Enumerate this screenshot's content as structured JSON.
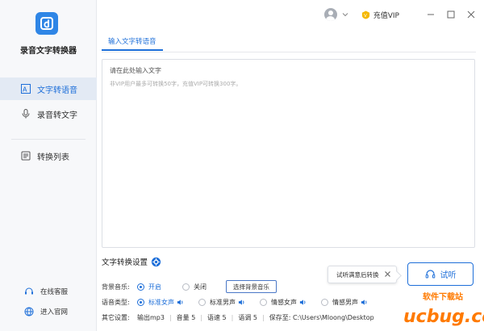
{
  "app": {
    "name": "录音文字转换器"
  },
  "sidebar": {
    "items": [
      {
        "label": "文字转语音",
        "icon": "text-to-speech-icon",
        "active": true
      },
      {
        "label": "录音转文字",
        "icon": "microphone-icon",
        "active": false
      },
      {
        "label": "转换列表",
        "icon": "list-icon",
        "active": false
      }
    ],
    "footer": [
      {
        "label": "在线客服",
        "icon": "headset-support-icon"
      },
      {
        "label": "进入官网",
        "icon": "globe-icon"
      }
    ]
  },
  "titlebar": {
    "vip_label": "充值VIP"
  },
  "tab": {
    "label": "输入文字转语音"
  },
  "editor": {
    "placeholder": "请在此处输入文字",
    "hint": "非VIP用户最多可转换50字，充值VIP可转换300字。"
  },
  "settings": {
    "title": "文字转换设置",
    "bgm": {
      "label": "背景音乐:",
      "options": [
        "开启",
        "关闭"
      ],
      "selected": "开启",
      "choose_button": "选择背景音乐"
    },
    "voice": {
      "label": "语音类型:",
      "options": [
        "标准女声",
        "标准男声",
        "情感女声",
        "情感男声"
      ],
      "selected": "标准女声"
    },
    "other": {
      "label": "其它设置:",
      "format": "输出mp3",
      "volume": "音量 5",
      "speed": "语速 5",
      "pitch": "语调 5",
      "save_to": "保存至: C:\\Users\\Mloong\\Desktop"
    }
  },
  "tooltip": {
    "text": "试听满意后转换"
  },
  "listen_button": {
    "label": "试听"
  },
  "watermark": {
    "text": "软件下载站",
    "brand": "ucbug.cc"
  },
  "colors": {
    "accent": "#1e6fd9",
    "logo": "#2f86e6",
    "vip_gold": "#f5b800",
    "watermark_orange": "#ff7a00"
  }
}
